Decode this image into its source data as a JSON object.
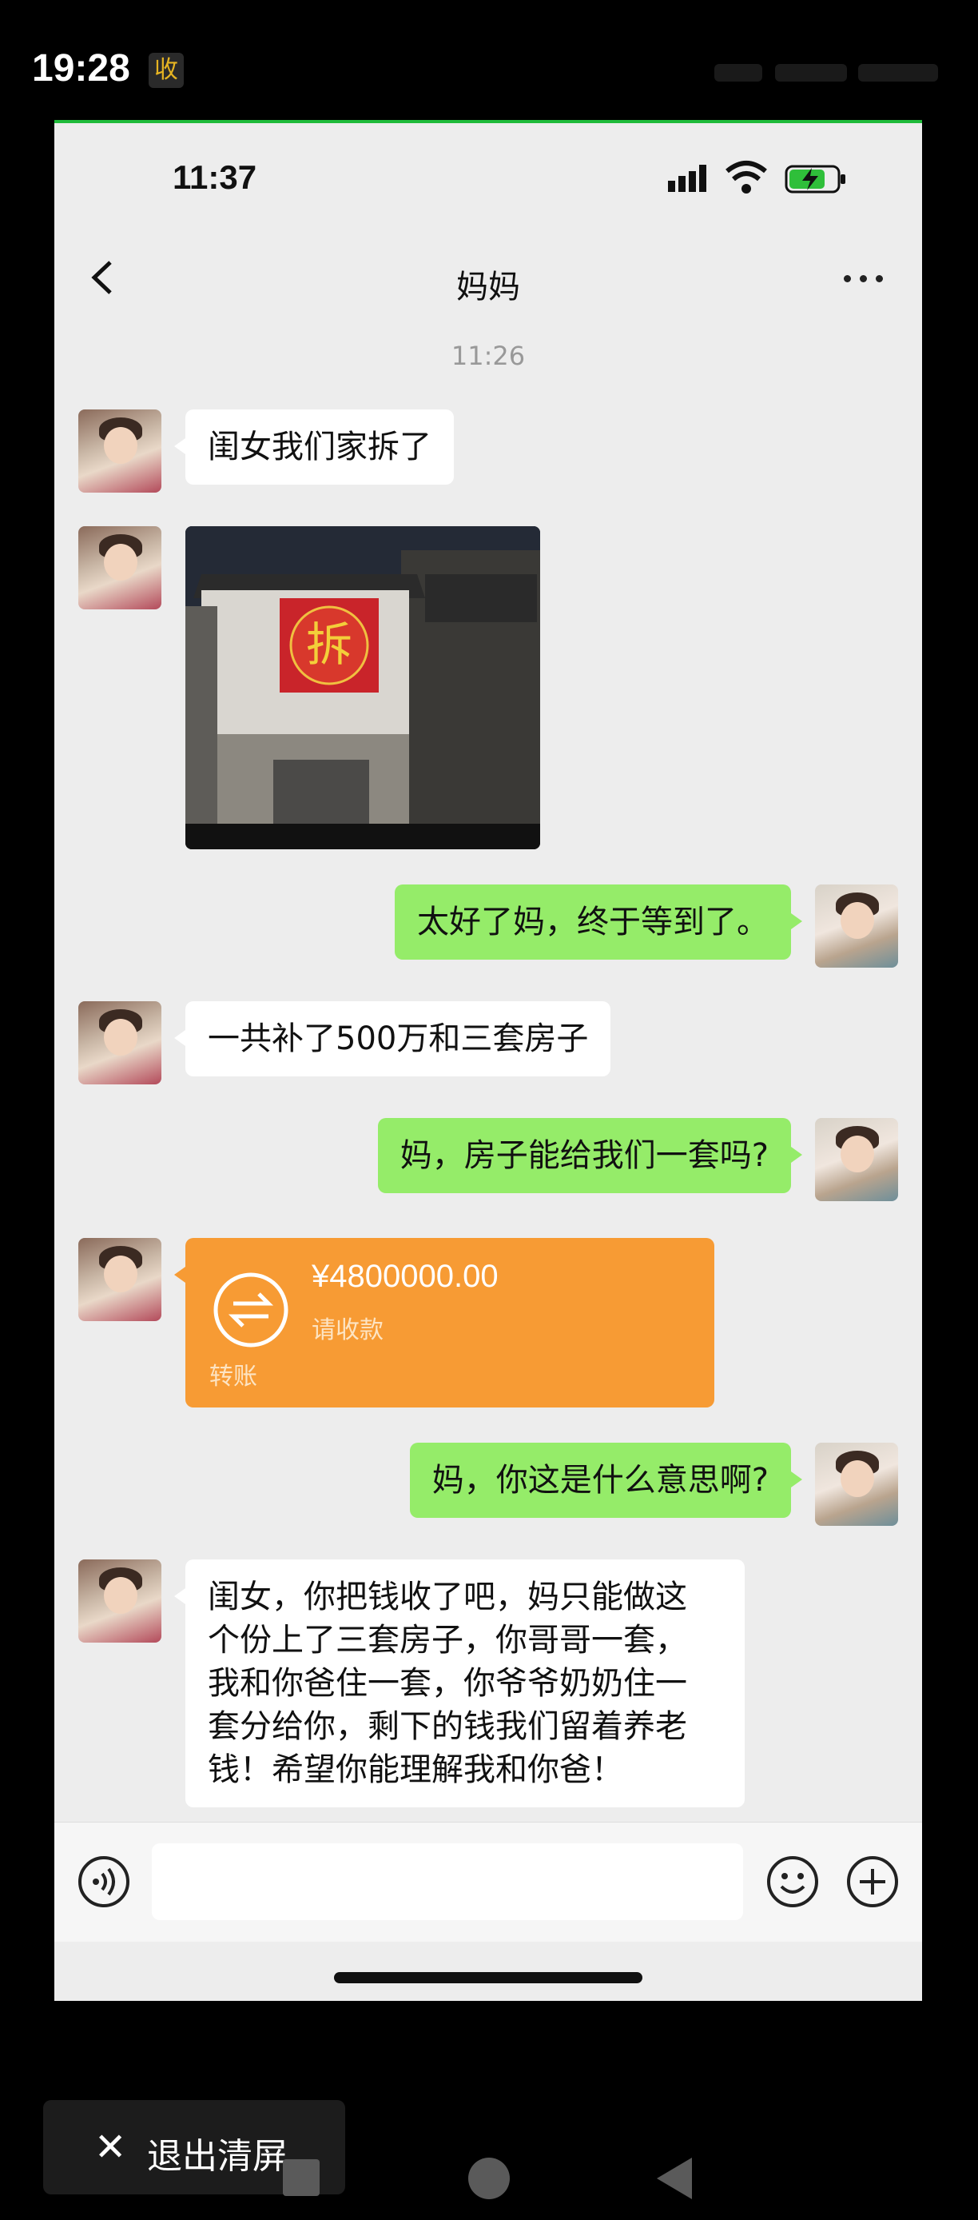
{
  "outer_status": {
    "time": "19:28",
    "badge": "收"
  },
  "inner_status": {
    "time": "11:37"
  },
  "chat": {
    "title": "妈妈",
    "timestamp": "11:26",
    "messages": [
      {
        "from": "mom",
        "type": "text",
        "text": "闺女我们家拆了"
      },
      {
        "from": "mom",
        "type": "image",
        "sign": "拆"
      },
      {
        "from": "me",
        "type": "text",
        "text": "太好了妈，终于等到了。"
      },
      {
        "from": "mom",
        "type": "text",
        "text": "一共补了500万和三套房子"
      },
      {
        "from": "me",
        "type": "text",
        "text": "妈，房子能给我们一套吗?"
      },
      {
        "from": "mom",
        "type": "transfer",
        "amount": "¥4800000.00",
        "subtitle": "请收款",
        "label": "转账"
      },
      {
        "from": "me",
        "type": "text",
        "text": "妈，你这是什么意思啊?"
      },
      {
        "from": "mom",
        "type": "text",
        "lines": [
          "闺女，你把钱收了吧，妈只能做这",
          "个份上了三套房子，你哥哥一套，",
          "我和你爸住一套，你爷爷奶奶住一",
          "套分给你，剩下的钱我们留着养老",
          "钱！希望你能理解我和你爸！"
        ]
      }
    ]
  },
  "input": {
    "value": "",
    "placeholder": ""
  },
  "bottom": {
    "exit_clean_label": "退出清屏"
  }
}
